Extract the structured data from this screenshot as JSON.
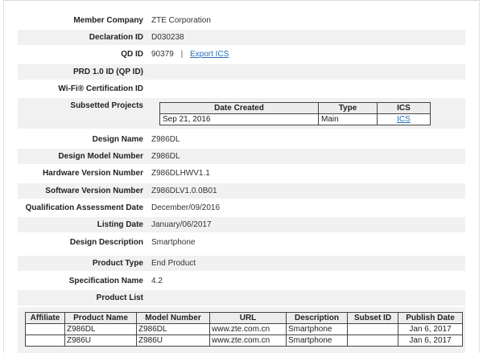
{
  "fields": {
    "member_company": {
      "label": "Member Company",
      "value": "ZTE Corporation"
    },
    "declaration_id": {
      "label": "Declaration ID",
      "value": "D030238"
    },
    "qd_id": {
      "label": "QD ID",
      "value": "90379",
      "separator": "|",
      "link": "Export ICS"
    },
    "prd_id": {
      "label": "PRD 1.0 ID (QP ID)",
      "value": ""
    },
    "wifi_cert": {
      "label": "Wi-Fi® Certification ID",
      "value": ""
    },
    "subsetted_projects": {
      "label": "Subsetted Projects"
    },
    "design_name": {
      "label": "Design Name",
      "value": "Z986DL"
    },
    "design_model_number": {
      "label": "Design Model Number",
      "value": "Z986DL"
    },
    "hardware_version": {
      "label": "Hardware Version Number",
      "value": "Z986DLHWV1.1"
    },
    "software_version": {
      "label": "Software Version Number",
      "value": "Z986DLV1.0.0B01"
    },
    "qualification_date": {
      "label": "Qualification Assessment Date",
      "value": "December/09/2016"
    },
    "listing_date": {
      "label": "Listing Date",
      "value": "January/06/2017"
    },
    "design_description": {
      "label": "Design Description",
      "value": "Smartphone"
    },
    "product_type": {
      "label": "Product Type",
      "value": "End Product"
    },
    "specification_name": {
      "label": "Specification Name",
      "value": "4.2"
    },
    "product_list": {
      "label": "Product List"
    }
  },
  "subsetted_table": {
    "headers": [
      "Date Created",
      "Type",
      "ICS"
    ],
    "rows": [
      {
        "date": "Sep 21, 2016",
        "type": "Main",
        "ics": "ICS"
      }
    ]
  },
  "product_table": {
    "headers": [
      "Affiliate",
      "Product Name",
      "Model Number",
      "URL",
      "Description",
      "Subset ID",
      "Publish Date"
    ],
    "rows": [
      {
        "affiliate": "",
        "product_name": "Z986DL",
        "model_number": "Z986DL",
        "url": "www.zte.com.cn",
        "description": "Smartphone",
        "subset_id": "",
        "publish_date": "Jan 6, 2017"
      },
      {
        "affiliate": "",
        "product_name": "Z986U",
        "model_number": "Z986U",
        "url": "www.zte.com.cn",
        "description": "Smartphone",
        "subset_id": "",
        "publish_date": "Jan 6, 2017"
      }
    ]
  }
}
